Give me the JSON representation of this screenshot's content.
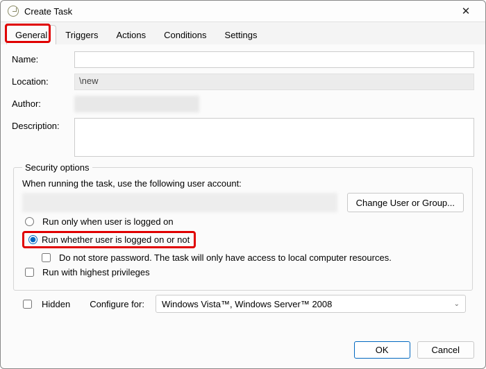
{
  "titlebar": {
    "title": "Create Task"
  },
  "tabs": {
    "general": "General",
    "triggers": "Triggers",
    "actions": "Actions",
    "conditions": "Conditions",
    "settings": "Settings"
  },
  "form": {
    "name_label": "Name:",
    "name_value": "",
    "location_label": "Location:",
    "location_value": "\\new",
    "author_label": "Author:",
    "description_label": "Description:",
    "description_value": ""
  },
  "security": {
    "legend": "Security options",
    "prompt": "When running the task, use the following user account:",
    "change_btn": "Change User or Group...",
    "radio_logged_on": "Run only when user is logged on",
    "radio_whether": "Run whether user is logged on or not",
    "chk_nostore": "Do not store password.  The task will only have access to local computer resources.",
    "chk_highest": "Run with highest privileges"
  },
  "bottom": {
    "hidden_label": "Hidden",
    "configure_label": "Configure for:",
    "configure_value": "Windows Vista™, Windows Server™ 2008"
  },
  "footer": {
    "ok": "OK",
    "cancel": "Cancel"
  }
}
